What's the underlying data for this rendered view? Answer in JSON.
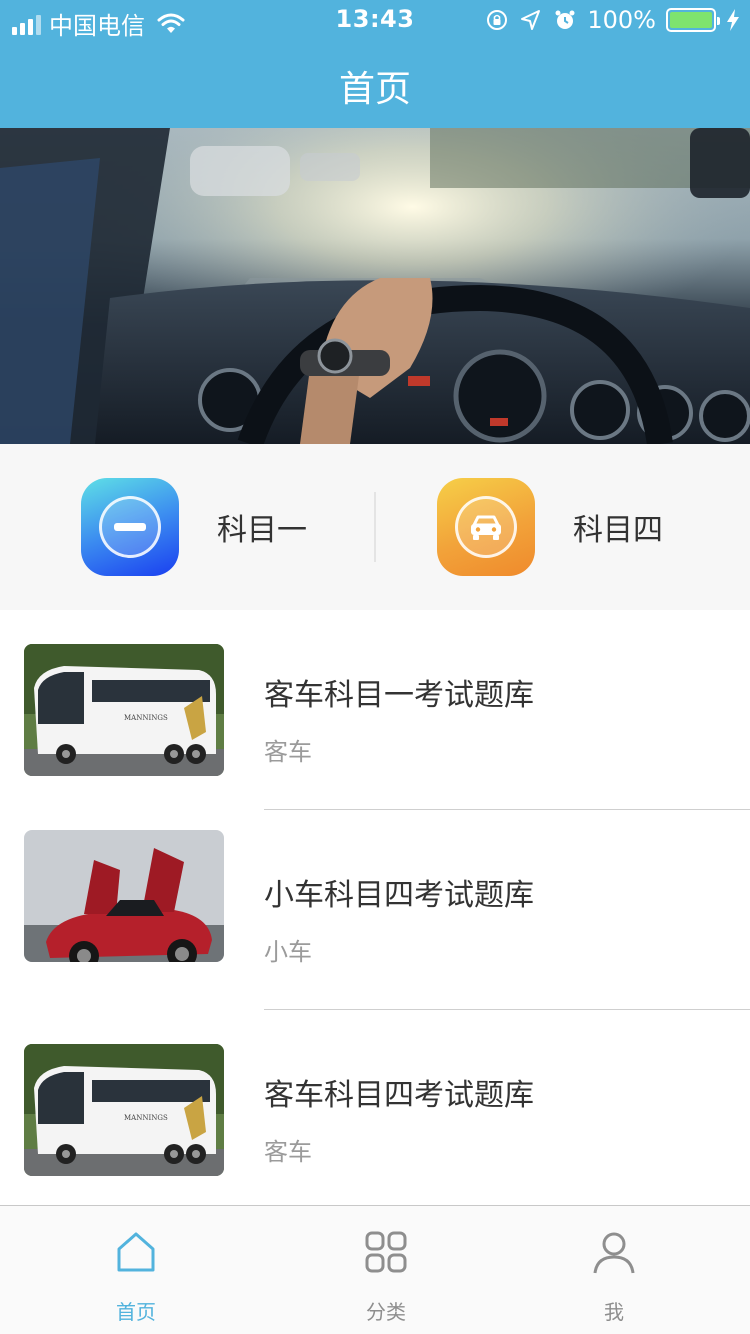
{
  "status_bar": {
    "carrier": "中国电信",
    "time": "13:43",
    "battery": "100%"
  },
  "nav": {
    "title": "首页"
  },
  "subjects": [
    {
      "label": "科目一",
      "icon": "minus-icon"
    },
    {
      "label": "科目四",
      "icon": "car-icon"
    }
  ],
  "list": [
    {
      "title": "客车科目一考试题库",
      "category": "客车",
      "image": "bus-image"
    },
    {
      "title": "小车科目四考试题库",
      "category": "小车",
      "image": "sports-car-image"
    },
    {
      "title": "客车科目四考试题库",
      "category": "客车",
      "image": "bus-image"
    }
  ],
  "tabs": [
    {
      "label": "首页",
      "icon": "home-icon",
      "active": true
    },
    {
      "label": "分类",
      "icon": "grid-icon",
      "active": false
    },
    {
      "label": "我",
      "icon": "user-icon",
      "active": false
    }
  ],
  "colors": {
    "accent": "#52b3dd",
    "blue_icon": "#2f6ff0",
    "orange_icon": "#f2a33a"
  }
}
